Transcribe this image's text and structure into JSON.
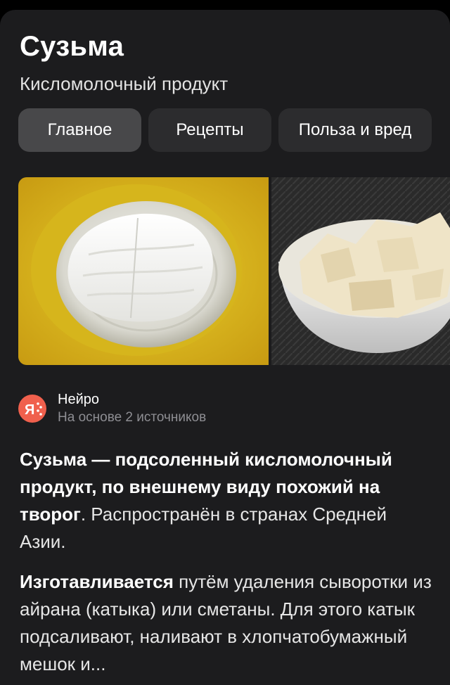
{
  "header": {
    "title": "Сузьма",
    "subtitle": "Кисломолочный продукт"
  },
  "tabs": [
    {
      "label": "Главное",
      "active": true
    },
    {
      "label": "Рецепты",
      "active": false
    },
    {
      "label": "Польза и вред",
      "active": false
    }
  ],
  "gallery": {
    "images": [
      {
        "icon": "suzma-on-plate-photo"
      },
      {
        "icon": "suzma-in-bowl-photo"
      }
    ]
  },
  "answer": {
    "source_name": "Нейро",
    "source_note": "На основе 2 источников",
    "logo_icon": "neiro-logo-icon",
    "p1_bold": "Сузьма — подсоленный кисломолочный продукт, по внешнему виду похожий на творог",
    "p1_rest": ". Распространён в странах Средней Азии.",
    "p2_bold": "Изготавливается",
    "p2_rest": " путём удаления сыворотки из айрана (катыка) или сметаны. Для этого катык подсаливают, наливают в хлопчатобумажный мешок и..."
  },
  "colors": {
    "background": "#000000",
    "card": "#1c1c1e",
    "tab": "#2c2c2e",
    "tab_active": "#48484a",
    "neiro_logo": "#f0604d"
  }
}
